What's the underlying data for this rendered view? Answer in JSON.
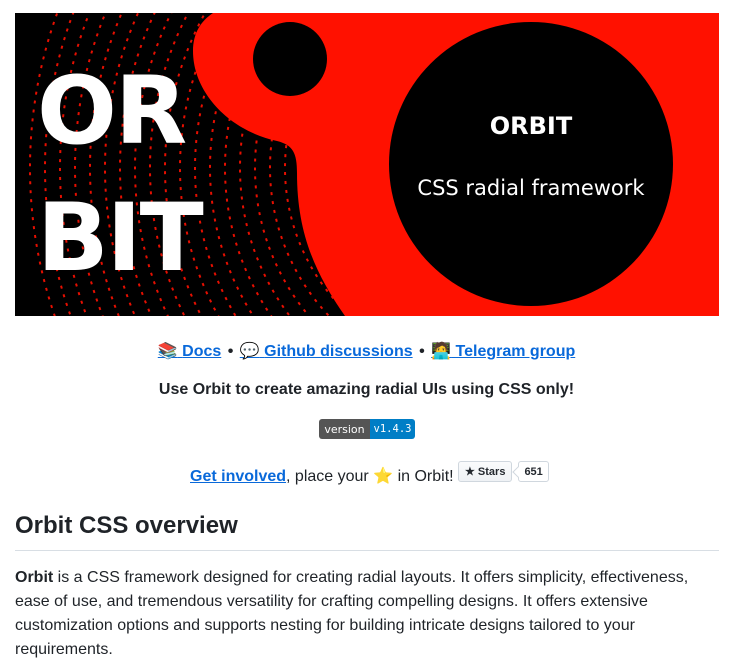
{
  "banner": {
    "big_text_line1": "OR",
    "big_text_line2": "BIT",
    "circle_title": "ORBIT",
    "circle_subtitle": "CSS radial framework",
    "colors": {
      "red": "#ff1100",
      "black": "#000000",
      "white": "#ffffff"
    }
  },
  "links": {
    "docs_icon": "📚",
    "docs_label": "Docs",
    "separator": "•",
    "discussions_icon": "💬",
    "discussions_label": "Github discussions",
    "telegram_icon": "🧑‍💻",
    "telegram_label": "Telegram group"
  },
  "tagline": "Use Orbit to create amazing radial UIs using CSS only!",
  "version_badge": {
    "label": "version",
    "value": "v1.4.3"
  },
  "involved": {
    "link_label": "Get involved",
    "text_before_star": ", place your",
    "star_emoji": "⭐",
    "text_after_star": "in Orbit!"
  },
  "stars_widget": {
    "label": "★ Stars",
    "count": "651"
  },
  "overview": {
    "heading": "Orbit CSS overview",
    "bold_word": "Orbit",
    "text": " is a CSS framework designed for creating radial layouts. It offers simplicity, effectiveness, ease of use, and tremendous versatility for crafting compelling designs. It offers extensive customization options and supports nesting for building intricate designs tailored to your requirements."
  }
}
